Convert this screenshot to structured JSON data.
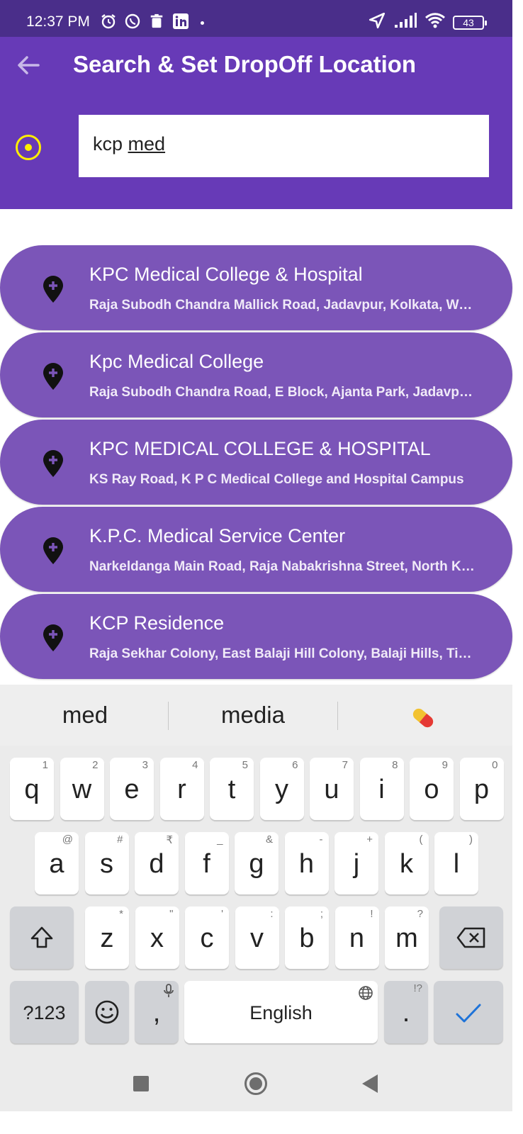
{
  "status_bar": {
    "time": "12:37 PM",
    "battery": "43"
  },
  "header": {
    "title": "Search & Set DropOff Location"
  },
  "search": {
    "typed_plain": "kcp ",
    "typed_underlined": "med"
  },
  "results": [
    {
      "title": "KPC Medical College & Hospital",
      "subtitle": "Raja Subodh Chandra Mallick Road, Jadavpur, Kolkata, West Bengal, India"
    },
    {
      "title": "Kpc Medical College",
      "subtitle": "Raja Subodh Chandra Road, E Block, Ajanta Park, Jadavpur, Kolkata"
    },
    {
      "title": "KPC MEDICAL COLLEGE & HOSPITAL",
      "subtitle": "KS Ray Road, K P C Medical College and Hospital Campus"
    },
    {
      "title": "K.P.C. Medical Service Center",
      "subtitle": "Narkeldanga Main Road, Raja Nabakrishna Street, North Kolkata"
    },
    {
      "title": "KCP Residence",
      "subtitle": "Raja Sekhar Colony, East Balaji Hill Colony, Balaji Hills, Tirupati"
    }
  ],
  "keyboard": {
    "suggestions": [
      "med",
      "media"
    ],
    "row1": [
      {
        "k": "q",
        "h": "1"
      },
      {
        "k": "w",
        "h": "2"
      },
      {
        "k": "e",
        "h": "3"
      },
      {
        "k": "r",
        "h": "4"
      },
      {
        "k": "t",
        "h": "5"
      },
      {
        "k": "y",
        "h": "6"
      },
      {
        "k": "u",
        "h": "7"
      },
      {
        "k": "i",
        "h": "8"
      },
      {
        "k": "o",
        "h": "9"
      },
      {
        "k": "p",
        "h": "0"
      }
    ],
    "row2": [
      {
        "k": "a",
        "h": "@"
      },
      {
        "k": "s",
        "h": "#"
      },
      {
        "k": "d",
        "h": "₹"
      },
      {
        "k": "f",
        "h": "_"
      },
      {
        "k": "g",
        "h": "&"
      },
      {
        "k": "h",
        "h": "-"
      },
      {
        "k": "j",
        "h": "+"
      },
      {
        "k": "k",
        "h": "("
      },
      {
        "k": "l",
        "h": ")"
      }
    ],
    "row3": [
      {
        "k": "z",
        "h": "*"
      },
      {
        "k": "x",
        "h": "\""
      },
      {
        "k": "c",
        "h": "'"
      },
      {
        "k": "v",
        "h": ":"
      },
      {
        "k": "b",
        "h": ";"
      },
      {
        "k": "n",
        "h": "!"
      },
      {
        "k": "m",
        "h": "?"
      }
    ],
    "symbols_label": "?123",
    "comma": ",",
    "space_label": "English",
    "period": ".",
    "period_hint": "!?"
  }
}
